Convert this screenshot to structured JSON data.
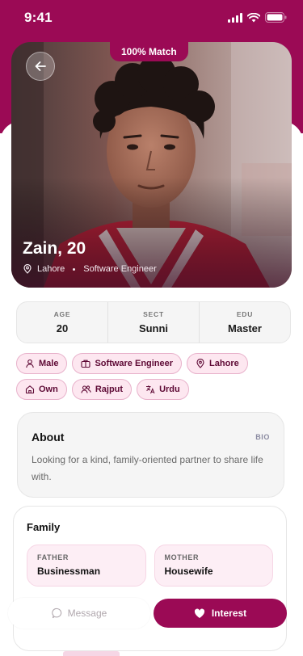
{
  "status_bar": {
    "time": "9:41"
  },
  "hero": {
    "match_badge": "100% Match",
    "name": "Zain, 20",
    "location": "Lahore",
    "profession": "Software Engineer"
  },
  "stats": [
    {
      "label": "AGE",
      "value": "20"
    },
    {
      "label": "SECT",
      "value": "Sunni"
    },
    {
      "label": "EDU",
      "value": "Master"
    }
  ],
  "chips": [
    {
      "icon": "person-icon",
      "label": "Male"
    },
    {
      "icon": "briefcase-icon",
      "label": "Software Engineer"
    },
    {
      "icon": "location-pin-icon",
      "label": "Lahore"
    },
    {
      "icon": "home-icon",
      "label": "Own"
    },
    {
      "icon": "people-icon",
      "label": "Rajput"
    },
    {
      "icon": "translate-icon",
      "label": "Urdu"
    }
  ],
  "about": {
    "title": "About",
    "tag": "BIO",
    "text": "Looking for a kind, family-oriented partner to share life with."
  },
  "family": {
    "title": "Family",
    "items": [
      {
        "label": "FATHER",
        "value": "Businessman"
      },
      {
        "label": "MOTHER",
        "value": "Housewife"
      }
    ]
  },
  "actions": {
    "message_label": "Message",
    "interest_label": "Interest"
  },
  "colors": {
    "brand": "#9b0a55",
    "chip_bg": "#fde7f0",
    "chip_border": "#e8b2cb"
  }
}
